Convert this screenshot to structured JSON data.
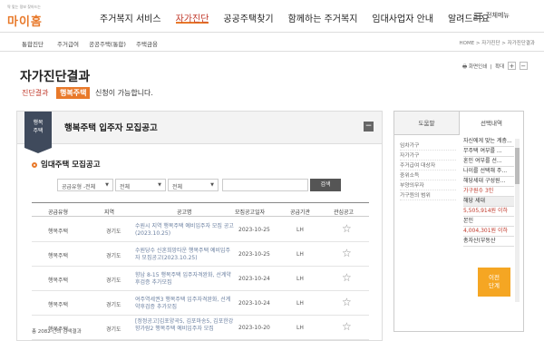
{
  "logo": {
    "tagline": "딱 맞는 정보 찾아드는",
    "name": "마이홈"
  },
  "gnb": [
    "주거복지 서비스",
    "자가진단",
    "공공주택찾기",
    "함께하는 주거복지",
    "임대사업자 안내",
    "알려드려요"
  ],
  "allmenu": "전체메뉴",
  "snb": [
    "통합진단",
    "주거급여",
    "공공주택(통합)",
    "주택금융"
  ],
  "breadcrumb": "HOME > 자가진단 > 자가진단결과",
  "page_title": "자가진단결과",
  "tools": {
    "print": "화면인쇄",
    "zoom": "확대",
    "plus": "+",
    "minus": "−"
  },
  "diagnosis": {
    "label": "진단결과",
    "badge": "행복주택",
    "text": "신청이 가능합니다."
  },
  "panel": {
    "badge": "행복\n주택",
    "title": "행복주택 입주자 모집공고",
    "minimize": "−",
    "section_title": "임대주택 모집공고",
    "filters": [
      "공급유형 -전체",
      "전체",
      "전체",
      "전체"
    ],
    "search_button": "검색",
    "columns": [
      "공급유형",
      "지역",
      "공고명",
      "모집공고일자",
      "공급기관",
      "관심공고"
    ],
    "rows": [
      {
        "type": "행복주택",
        "region": "경기도",
        "title": "수원시 지역 행복주택 예비입주자 모집 공고(2023.10.25)",
        "date": "2023-10-25",
        "org": "LH"
      },
      {
        "type": "행복주택",
        "region": "경기도",
        "title": "수원당수 신혼희망타운 행복주택 예비입주자 모집공고(2023.10.25)",
        "date": "2023-10-25",
        "org": "LH"
      },
      {
        "type": "행복주택",
        "region": "경기도",
        "title": "향남 8-15 행복주택 입주자격완화, 선계약후검증 추가모집",
        "date": "2023-10-24",
        "org": "LH"
      },
      {
        "type": "행복주택",
        "region": "경기도",
        "title": "여주역세권3 행복주택 입주자격완화, 선계약후검증 추가모집",
        "date": "2023-10-24",
        "org": "LH"
      },
      {
        "type": "행복주택",
        "region": "경기도",
        "title": "[정정공고]김포양곡5, 김포마송5, 김포한강향가람2 행복주택 예비입주자 모집",
        "date": "2023-10-20",
        "org": "LH"
      }
    ],
    "star": "☆",
    "total": "총 2082 건의 검색결과"
  },
  "right_panel": {
    "tab_help": "도움말",
    "tab_select": "선택내역",
    "help_items": [
      "임차가구",
      "자가가구",
      "주거급여 대상자",
      "중위소득",
      "부양의무자",
      "가구원의 범위"
    ],
    "select_items": [
      {
        "text": "자신에게 맞는 계층...",
        "hl": false
      },
      {
        "text": "무주택 여부를 ...",
        "hl": false
      },
      {
        "text": "혼인 여부를 선...",
        "hl": false
      },
      {
        "text": "나이를 선택해 주...",
        "hl": false
      },
      {
        "text": "해당세대 구성원...",
        "hl": false
      },
      {
        "text": "가구원수      3인",
        "hl": true
      },
      {
        "text": "해당 세대",
        "hl": false
      },
      {
        "text": "5,505,914원 이하",
        "hl": true
      },
      {
        "text": "본인",
        "hl": false
      },
      {
        "text": "4,004,301원 이하",
        "hl": true
      },
      {
        "text": "총자산(부동산",
        "hl": false
      }
    ],
    "prev_button": "이전\n단계"
  }
}
